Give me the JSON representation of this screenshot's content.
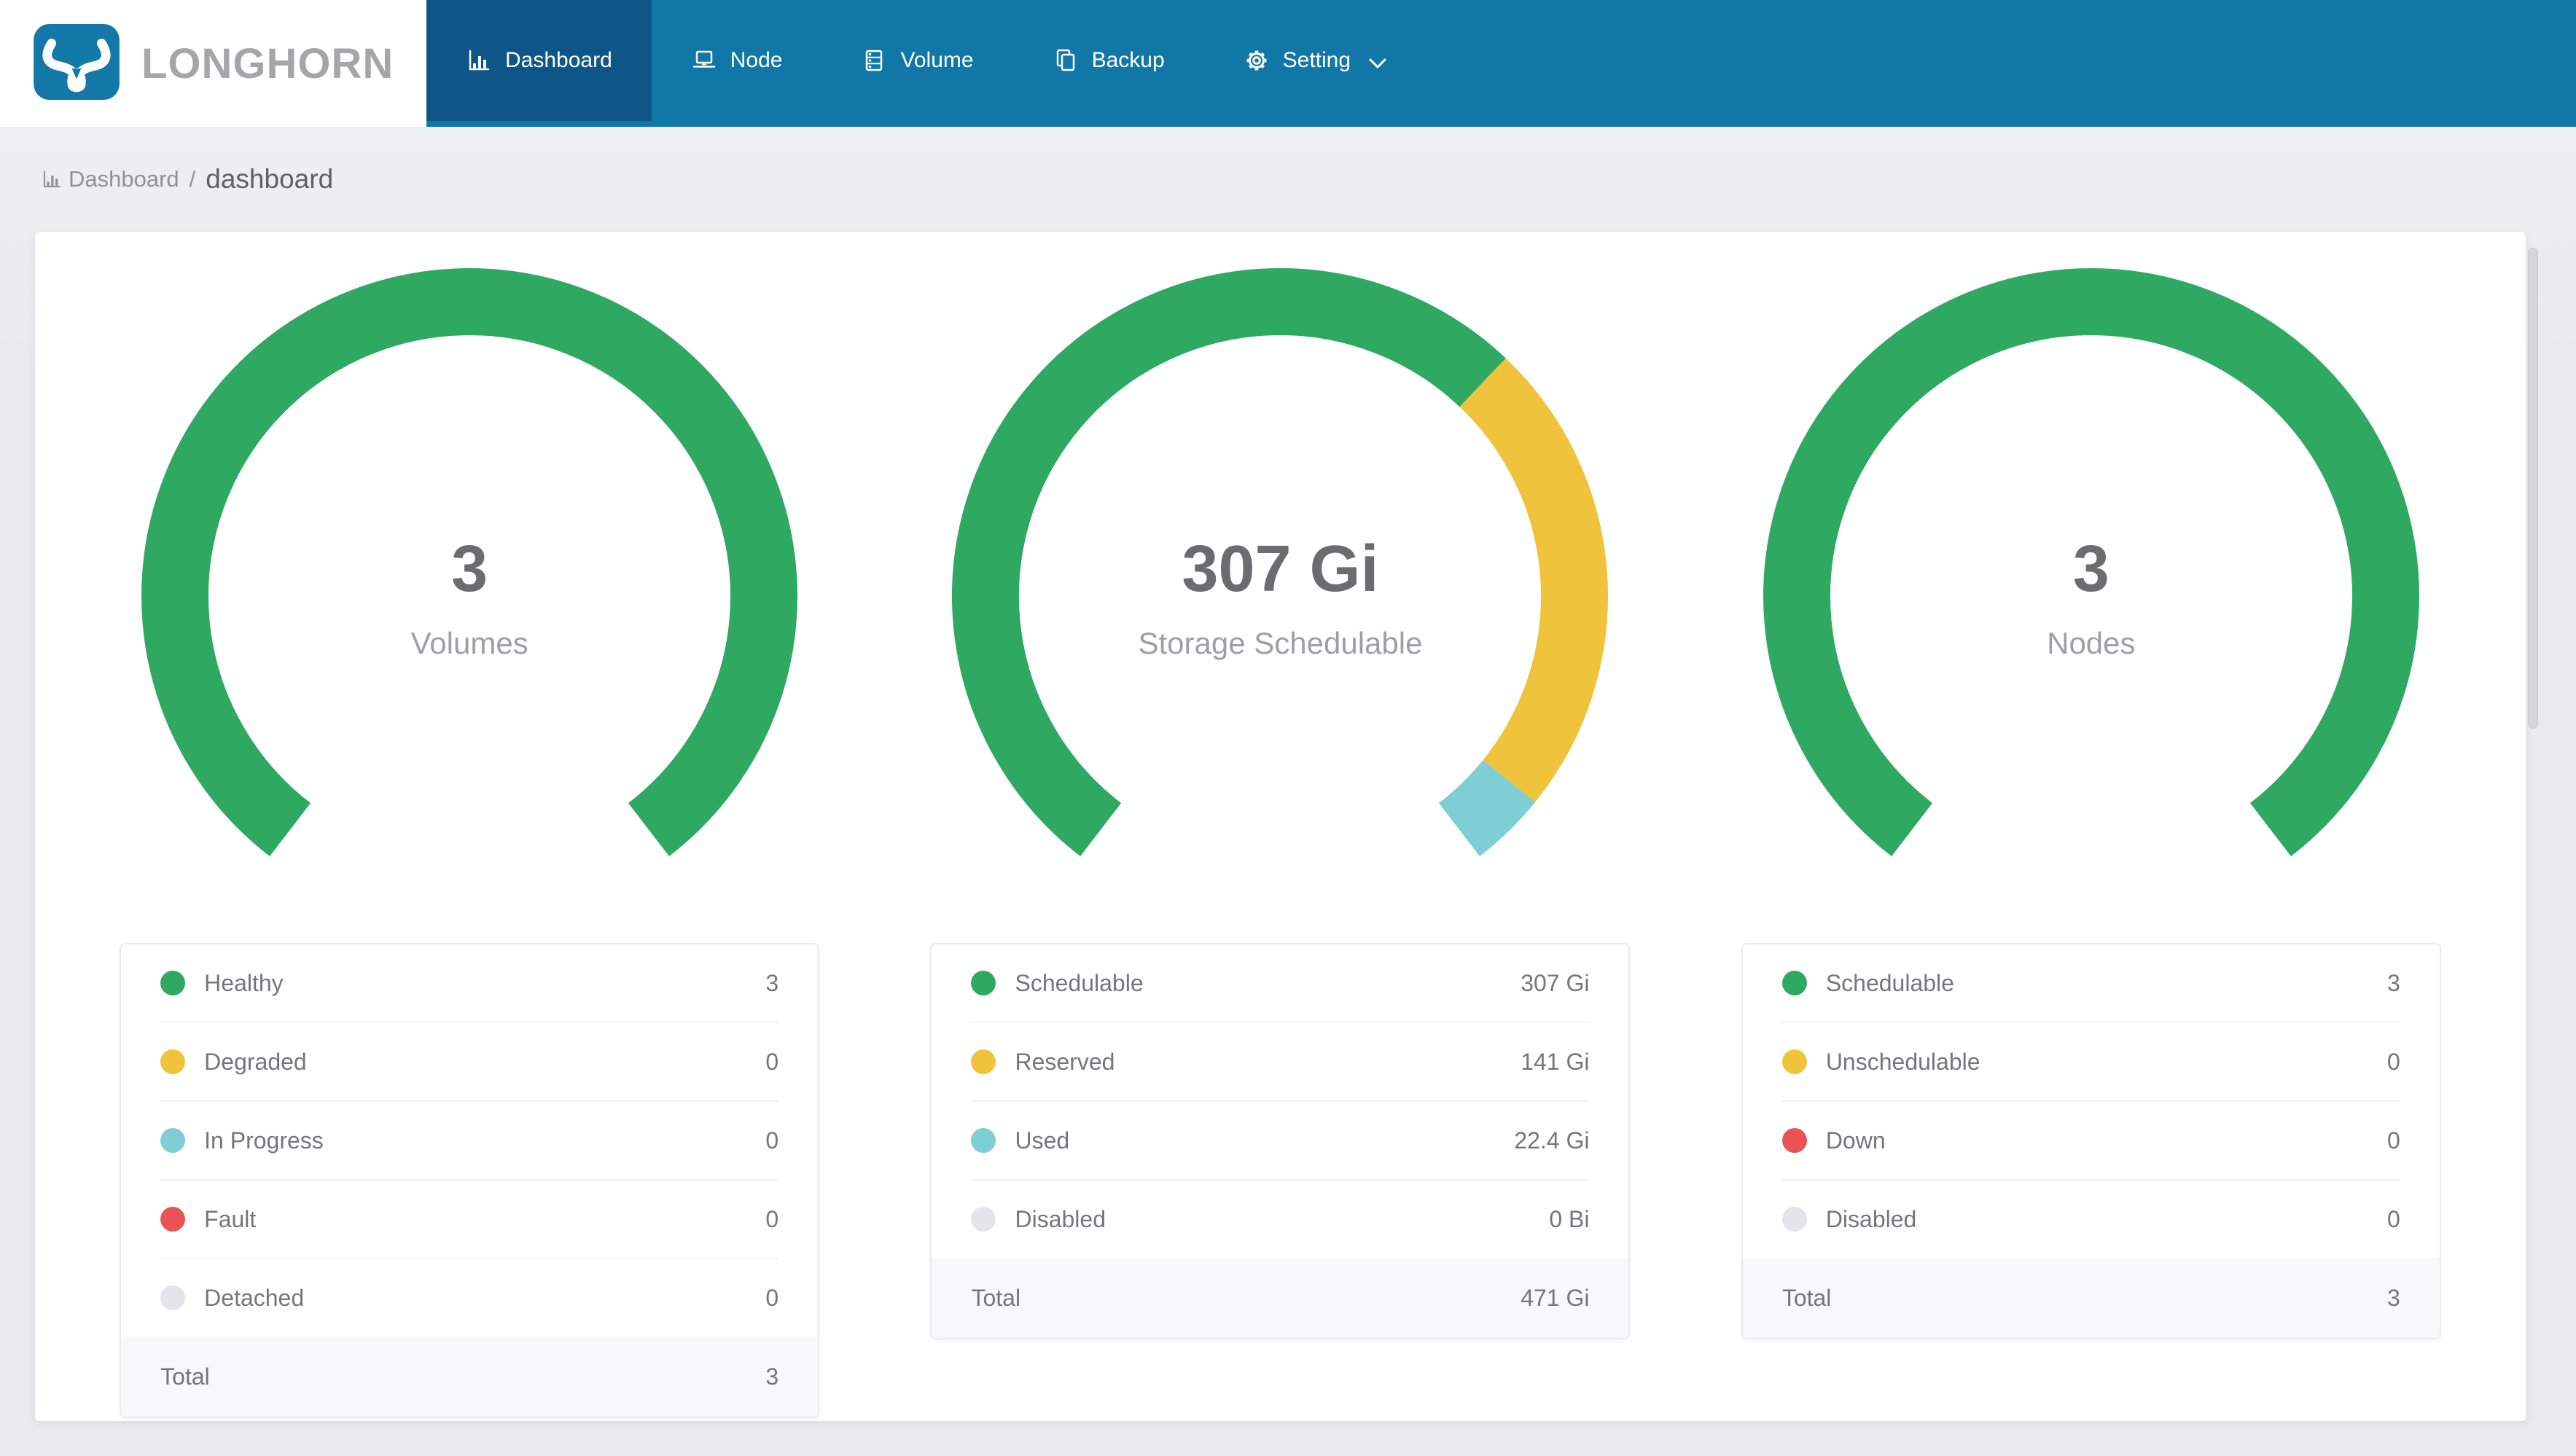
{
  "nav": {
    "brand": "LONGHORN",
    "items": [
      {
        "label": "Dashboard",
        "icon": "bar-chart-icon",
        "active": true
      },
      {
        "label": "Node",
        "icon": "laptop-icon",
        "active": false
      },
      {
        "label": "Volume",
        "icon": "server-icon",
        "active": false
      },
      {
        "label": "Backup",
        "icon": "copy-icon",
        "active": false
      },
      {
        "label": "Setting",
        "icon": "gear-icon",
        "active": false,
        "has_dropdown": true
      }
    ]
  },
  "breadcrumb": {
    "section": "Dashboard",
    "separator": "/",
    "page": "dashboard"
  },
  "colors": {
    "nav_blue": "#1077a7",
    "active_tab_blue": "#0e5588",
    "healthy_green": "#2fa962",
    "warning_yellow": "#f0c33d",
    "progress_teal": "#7fcdd5",
    "fault_red": "#ea5355",
    "disabled_gray": "#e2e5e9"
  },
  "chart_data": [
    {
      "type": "gauge",
      "center_value": "3",
      "center_label": "Volumes",
      "arc_span_deg": 285,
      "items": [
        {
          "label": "Healthy",
          "display": "3",
          "value": 3,
          "color": "#2fa962"
        },
        {
          "label": "Degraded",
          "display": "0",
          "value": 0,
          "color": "#f0c33d"
        },
        {
          "label": "In Progress",
          "display": "0",
          "value": 0,
          "color": "#7fcdd5"
        },
        {
          "label": "Fault",
          "display": "0",
          "value": 0,
          "color": "#ea5355"
        },
        {
          "label": "Detached",
          "display": "0",
          "value": 0,
          "color": "#e2e5e9"
        }
      ],
      "total": {
        "label": "Total",
        "display": "3"
      }
    },
    {
      "type": "gauge",
      "center_value": "307 Gi",
      "center_label": "Storage Schedulable",
      "arc_span_deg": 285,
      "items": [
        {
          "label": "Schedulable",
          "display": "307 Gi",
          "value": 307,
          "color": "#2fa962"
        },
        {
          "label": "Reserved",
          "display": "141 Gi",
          "value": 141,
          "color": "#f0c33d"
        },
        {
          "label": "Used",
          "display": "22.4 Gi",
          "value": 22.4,
          "color": "#7fcdd5"
        },
        {
          "label": "Disabled",
          "display": "0 Bi",
          "value": 0,
          "color": "#e2e5e9"
        }
      ],
      "total": {
        "label": "Total",
        "display": "471 Gi"
      }
    },
    {
      "type": "gauge",
      "center_value": "3",
      "center_label": "Nodes",
      "arc_span_deg": 285,
      "items": [
        {
          "label": "Schedulable",
          "display": "3",
          "value": 3,
          "color": "#2fa962"
        },
        {
          "label": "Unschedulable",
          "display": "0",
          "value": 0,
          "color": "#f0c33d"
        },
        {
          "label": "Down",
          "display": "0",
          "value": 0,
          "color": "#ea5355"
        },
        {
          "label": "Disabled",
          "display": "0",
          "value": 0,
          "color": "#e2e5e9"
        }
      ],
      "total": {
        "label": "Total",
        "display": "3"
      }
    }
  ]
}
